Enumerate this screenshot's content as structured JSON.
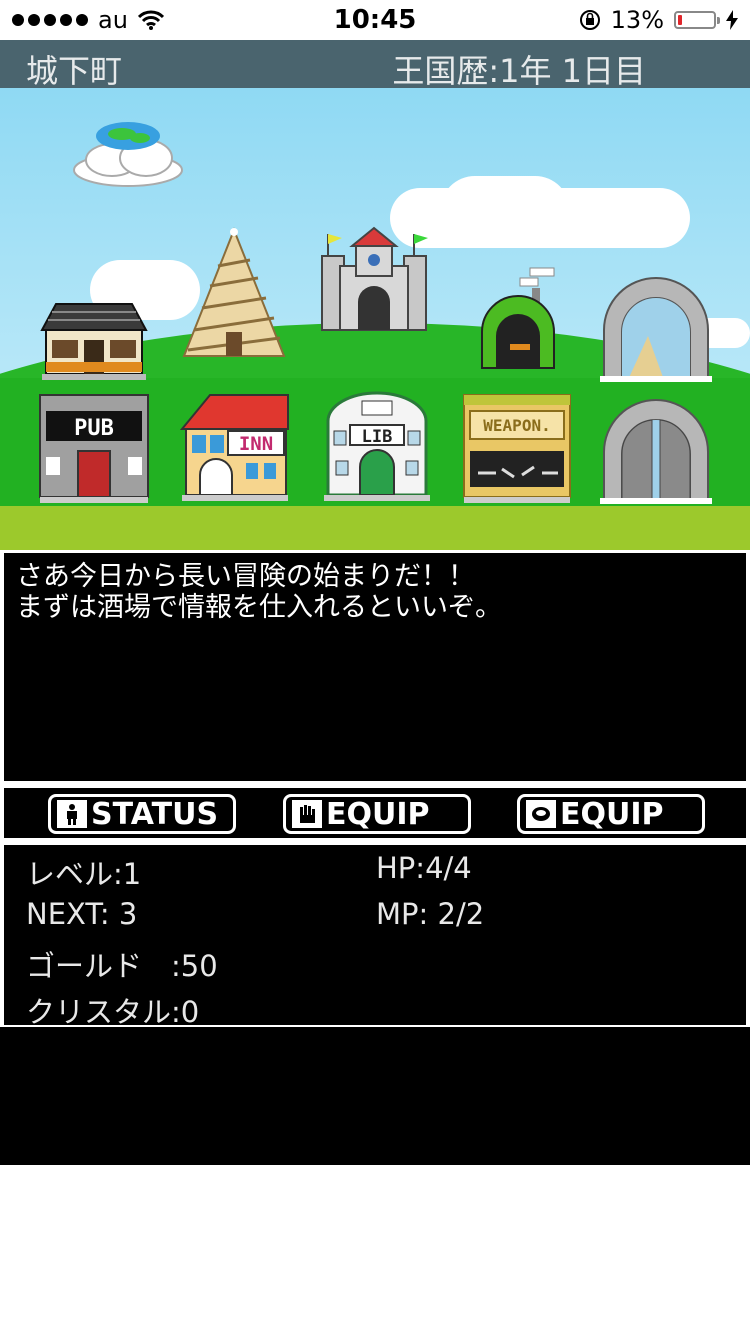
{
  "status_bar": {
    "carrier": "au",
    "time": "10:45",
    "battery_percent": "13%",
    "battery_level": 0.13,
    "battery_color": "#e0262b"
  },
  "header": {
    "location": "城下町",
    "date": "王国歴:1年 1日目"
  },
  "scene": {
    "buildings": [
      {
        "name": "house",
        "sign": ""
      },
      {
        "name": "tower",
        "sign": ""
      },
      {
        "name": "castle",
        "sign": ""
      },
      {
        "name": "cave",
        "sign": ""
      },
      {
        "name": "stone-gate",
        "sign": ""
      },
      {
        "name": "pub",
        "sign": "PUB"
      },
      {
        "name": "inn",
        "sign": "INN"
      },
      {
        "name": "library",
        "sign": "LIB"
      },
      {
        "name": "weapon-shop",
        "sign": "WEAPON."
      },
      {
        "name": "town-gate",
        "sign": ""
      }
    ]
  },
  "message": {
    "line1": "さあ今日から長い冒険の始まりだ！！",
    "line2": "まずは酒場で情報を仕入れるといいぞ。"
  },
  "buttons": [
    {
      "label": "STATUS",
      "icon": "person-icon"
    },
    {
      "label": "EQUIP",
      "icon": "hand-icon"
    },
    {
      "label": "EQUIP",
      "icon": "eye-icon"
    }
  ],
  "stats": {
    "level": "レベル:1",
    "hp": "HP:4/4",
    "next": "NEXT: 3",
    "mp": "MP: 2/2",
    "gold": "ゴールド　:50",
    "crystal": "クリスタル:0"
  },
  "colors": {
    "header_bg": "#4a646e",
    "sky": "#8fd9f3",
    "grass": "#22b122",
    "ground": "#9cc92c",
    "panel_bg": "#000000"
  }
}
